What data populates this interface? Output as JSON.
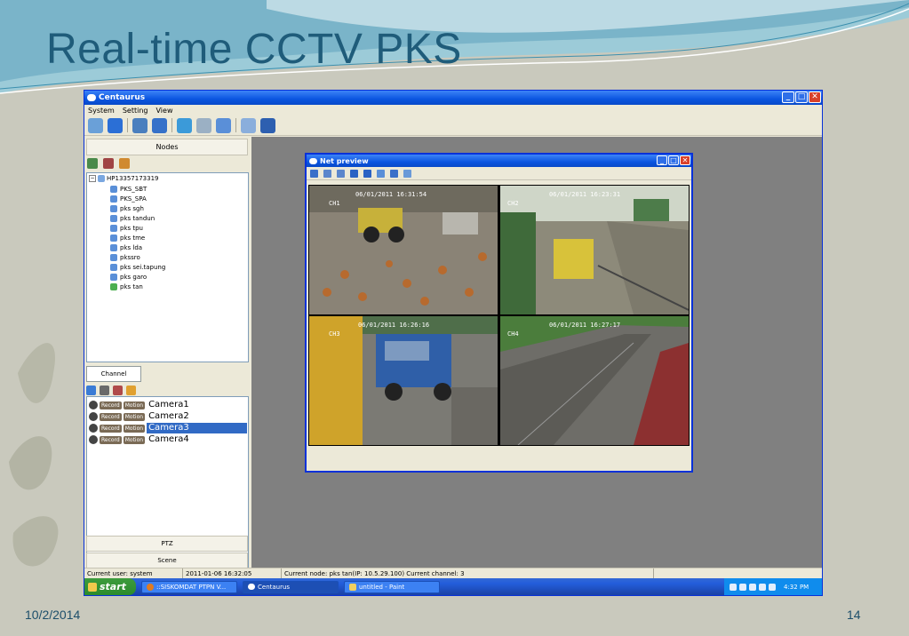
{
  "slide": {
    "title": "Real-time CCTV PKS",
    "date": "10/2/2014",
    "page_number": "14"
  },
  "window": {
    "title": "Centaurus",
    "menu": [
      "System",
      "Setting",
      "View"
    ],
    "controls": [
      "minimize",
      "maximize",
      "close"
    ]
  },
  "nodes_panel": {
    "header": "Nodes",
    "root": "HP13357173319",
    "items": [
      "PKS_SBT",
      "PKS_SPA",
      "pks sgh",
      "pks tandun",
      "pks tpu",
      "pks tme",
      "pks lda",
      "pkssro",
      "pks sei.tapung",
      "pks garo",
      "pks tan"
    ]
  },
  "channel_panel": {
    "tab": "Channel",
    "record_label": "Record",
    "motion_label": "Motion",
    "cameras": [
      "Camera1",
      "Camera2",
      "Camera3",
      "Camera4"
    ],
    "selected": "Camera3"
  },
  "buttons": {
    "ptz": "PTZ",
    "scene": "Scene"
  },
  "status_bar": {
    "user": "Current user: system",
    "datetime": "2011-01-06 16:32:05",
    "node": "Current node: pks tan(IP: 10.5.29.100) Current channel: 3"
  },
  "preview": {
    "title": "Net preview",
    "feeds": [
      {
        "channel": "CH1",
        "timestamp": "06/01/2011 16:31:54"
      },
      {
        "channel": "CH2",
        "timestamp": "06/01/2011 16:23:31"
      },
      {
        "channel": "CH3",
        "timestamp": "06/01/2011 16:26:16"
      },
      {
        "channel": "CH4",
        "timestamp": "06/01/2011 16:27:17"
      }
    ]
  },
  "taskbar": {
    "start": "start",
    "tasks": [
      "::SISKOMDAT PTPN V...",
      "Centaurus",
      "untitled - Paint"
    ],
    "clock": "4:32 PM"
  },
  "colors": {
    "title_text": "#1f5c7a",
    "xp_blue": "#0a55e0",
    "selection": "#316ac5"
  }
}
